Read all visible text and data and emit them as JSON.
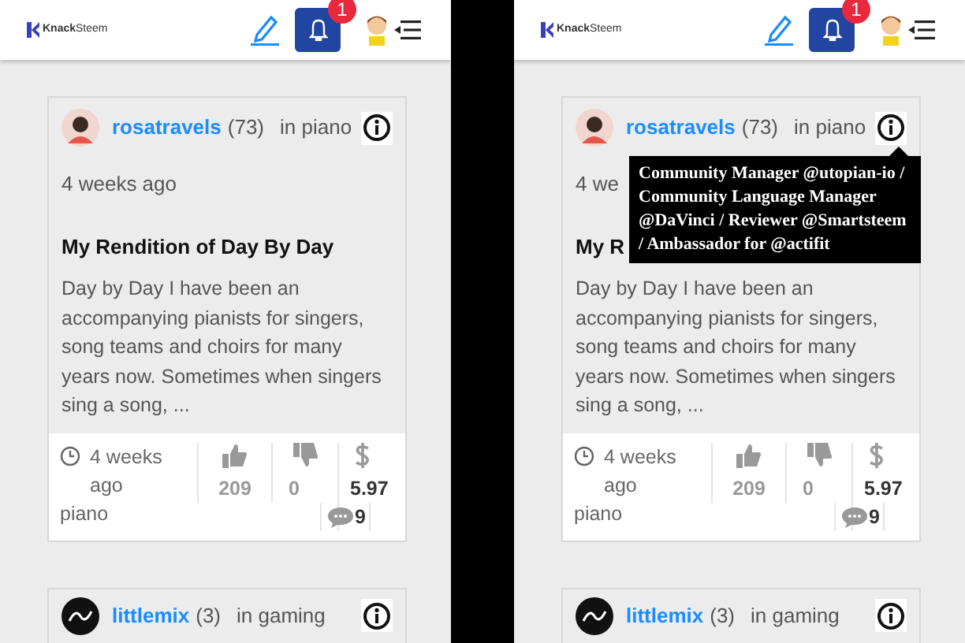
{
  "panels": [
    {
      "header": {
        "logo": "**Knack**Steem",
        "notification_count": "1"
      },
      "posts": [
        {
          "kind": "full",
          "author": "rosatravels",
          "reputation": "(73)",
          "category": "in piano",
          "time": "4 weeks ago",
          "title": "My Rendition of Day By Day",
          "excerpt": "Day by Day I have been an accompanying pianists for singers, song teams and choirs for many years now. Sometimes when singers sing a song, ...",
          "footer_time": "4 weeks ago",
          "tag": "piano",
          "upvotes": "209",
          "downvotes": "0",
          "payout": "5.97",
          "comments": "9"
        },
        {
          "kind": "header",
          "author": "littlemix",
          "reputation": "(3)",
          "category": "in gaming"
        }
      ]
    },
    {
      "header": {
        "logo": "**Knack**Steem",
        "notification_count": "1"
      },
      "posts": [
        {
          "kind": "full",
          "author": "rosatravels",
          "reputation": "(73)",
          "category": "in piano",
          "time": "4 we",
          "title": "My R",
          "excerpt": "Day by Day I have been an accompanying pianists for singers, song teams and choirs for many years now. Sometimes when singers sing a song, ...",
          "footer_time": "4 weeks ago",
          "tag": "piano",
          "upvotes": "209",
          "downvotes": "0",
          "payout": "5.97",
          "comments": "9"
        },
        {
          "kind": "header",
          "author": "littlemix",
          "reputation": "(3)",
          "category": "in gaming"
        }
      ],
      "tooltip": "Community Manager @utopian-io / Community Language Manager @DaVinci / Reviewer @Smartsteem / Ambassador for @actifit"
    }
  ]
}
